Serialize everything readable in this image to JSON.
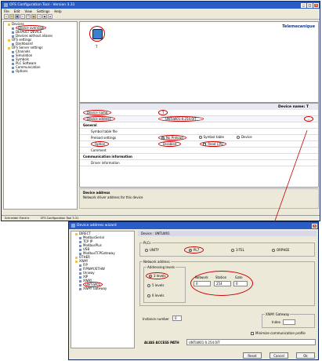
{
  "main_window": {
    "title": "OFS Configuration Tool - Version 3.31",
    "menu": [
      "File",
      "Edit",
      "View",
      "Settings",
      "Help"
    ],
    "toolbar_icons": [
      "new-icon",
      "open-icon",
      "save-icon",
      "cut-icon",
      "copy-icon",
      "paste-icon",
      "delete-icon",
      "print-icon",
      "help-icon"
    ],
    "logo": "Telemecanique",
    "tree": [
      {
        "label": "Devices",
        "indent": 1
      },
      {
        "label": "Device overview",
        "indent": 2
      },
      {
        "label": "DEFAULT DEVICE",
        "indent": 2
      },
      {
        "label": "Devices without aliases",
        "indent": 2
      },
      {
        "label": "OFS settings",
        "indent": 1
      },
      {
        "label": "Dashboard",
        "indent": 2
      },
      {
        "label": "OFS Server settings",
        "indent": 1
      },
      {
        "label": "Channels",
        "indent": 2
      },
      {
        "label": "Simulation",
        "indent": 2
      },
      {
        "label": "Symbols",
        "indent": 2
      },
      {
        "label": "PLC Software",
        "indent": 2
      },
      {
        "label": "Communication",
        "indent": 2
      },
      {
        "label": "Options",
        "indent": 2
      }
    ],
    "device_tile_label": "T",
    "device_name_header": "Device name: T",
    "props": [
      {
        "label": "Device name",
        "value": "T"
      },
      {
        "label": "Device address",
        "value": "UNTLW01:0.254.0/T"
      },
      {
        "label": "General",
        "value": ""
      },
      {
        "label": "Symbol table file",
        "value": ""
      },
      {
        "label": "Preload settings",
        "value": ""
      },
      {
        "label": "Option",
        "value": ""
      },
      {
        "label": "Comment",
        "value": ""
      },
      {
        "label": "Communication information",
        "value": ""
      },
      {
        "label": "Driver information",
        "value": ""
      }
    ],
    "preload_options": [
      "No Preload",
      "Symbol table",
      "Device"
    ],
    "option_values": [
      "Disabled",
      "Read CPU"
    ],
    "help_title": "Device address",
    "help_text": "Network driver address for this device",
    "status": [
      "Schneider Electric",
      "OFS Configuration Tool 3.31"
    ]
  },
  "wizard": {
    "title": "Device address wizard",
    "header_label": "Device : UNTLW01",
    "tree": [
      {
        "label": "DIRECT",
        "indent": 1
      },
      {
        "label": "ModbusSerial",
        "indent": 2
      },
      {
        "label": "TCP IP",
        "indent": 2
      },
      {
        "label": "ModbusPlus",
        "indent": 2
      },
      {
        "label": "USB",
        "indent": 2
      },
      {
        "label": "ModbusTCPGateway",
        "indent": 2
      },
      {
        "label": "OTHER",
        "indent": 1
      },
      {
        "label": "XWAY",
        "indent": 1
      },
      {
        "label": "FIP",
        "indent": 2
      },
      {
        "label": "FIPWAY/ETHW",
        "indent": 2
      },
      {
        "label": "Uniway",
        "indent": 2
      },
      {
        "label": "XIP",
        "indent": 2
      },
      {
        "label": "XWAY",
        "indent": 2
      },
      {
        "label": "UNTLW01",
        "indent": 2
      },
      {
        "label": "XWAY Gateway",
        "indent": 2
      }
    ],
    "plcs_label": "PLCs",
    "plc_options": [
      "UNITY",
      "PL7",
      "3-TEL",
      "ORPHEE"
    ],
    "plc_selected": "PL7",
    "net_address_label": "Network address",
    "addressing_label": "Addressing levels",
    "level_options": [
      "3 levels",
      "5 levels",
      "6 levels"
    ],
    "level_selected": "3 levels",
    "network_label": "Network",
    "station_label": "Station",
    "gate_label": "Gate",
    "network_value": "0",
    "station_value": "254",
    "gate_value": "0",
    "xway_gateway_label": "XWAY Gateway",
    "index_label": "Index",
    "index_value": "",
    "instance_label": "Instance number",
    "instance_value": "0",
    "minimize_label": "Minimize communication profile",
    "alias_label": "ALIAS ACCESS PATH",
    "alias_value": "UNTLW01:0.254.0/T",
    "buttons": {
      "reset": "Reset",
      "cancel": "Cancel",
      "ok": "Ok"
    }
  }
}
